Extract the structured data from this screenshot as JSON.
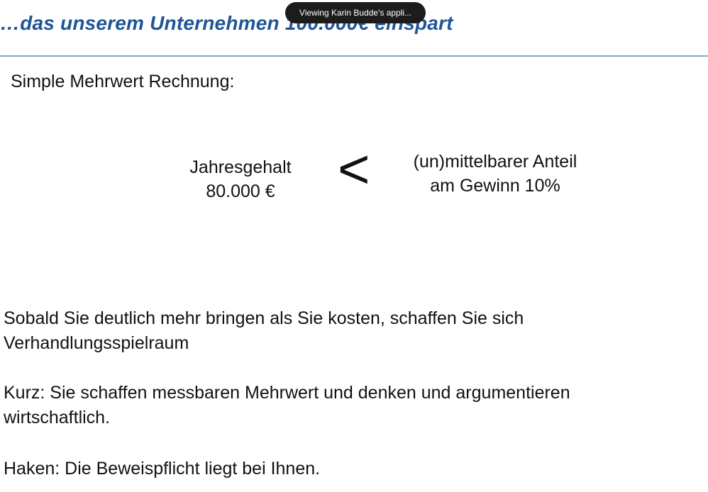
{
  "screen_share_banner": "Viewing Karin Budde's appli...",
  "slide": {
    "title": "…das unserem Unternehmen 100.000€ einspart",
    "subheading": "Simple Mehrwert Rechnung:",
    "comparison": {
      "left_line1": "Jahresgehalt",
      "left_line2": "80.000 €",
      "operator": "<",
      "right_line1": "(un)mittelbarer Anteil",
      "right_line2": "am Gewinn 10%"
    },
    "paragraphs": [
      {
        "line1": "Sobald Sie deutlich mehr bringen als Sie kosten, schaffen Sie sich",
        "line2": "Verhandlungsspielraum"
      },
      {
        "line1": "Kurz: Sie schaffen messbaren Mehrwert und denken und argumentieren",
        "line2": "wirtschaftlich."
      },
      {
        "line1": "Haken: Die Beweispflicht liegt bei Ihnen."
      }
    ]
  },
  "colors": {
    "title": "#1f5597",
    "rule": "#8aa2b6",
    "banner_bg": "#1c1c1c",
    "text": "#111111"
  }
}
